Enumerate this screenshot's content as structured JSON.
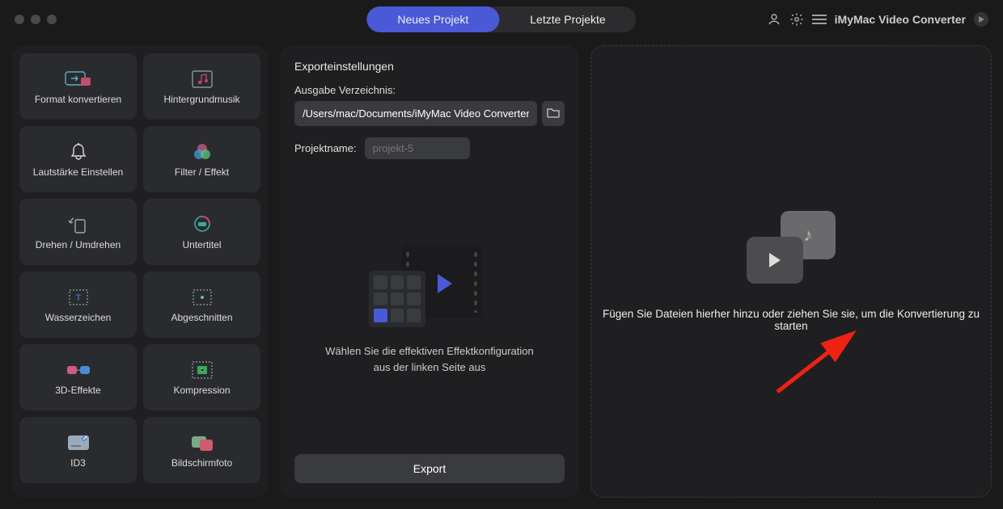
{
  "header": {
    "tab_new": "Neues Projekt",
    "tab_recent": "Letzte Projekte",
    "brand": "iMyMac Video Converter"
  },
  "tools": [
    {
      "id": "format-konvertieren",
      "label": "Format konvertieren"
    },
    {
      "id": "hintergrundmusik",
      "label": "Hintergrundmusik"
    },
    {
      "id": "lautstaerke",
      "label": "Lautstärke Einstellen"
    },
    {
      "id": "filter-effekt",
      "label": "Filter / Effekt"
    },
    {
      "id": "drehen",
      "label": "Drehen / Umdrehen"
    },
    {
      "id": "untertitel",
      "label": "Untertitel"
    },
    {
      "id": "wasserzeichen",
      "label": "Wasserzeichen"
    },
    {
      "id": "abgeschnitten",
      "label": "Abgeschnitten"
    },
    {
      "id": "3d-effekte",
      "label": "3D-Effekte"
    },
    {
      "id": "kompression",
      "label": "Kompression"
    },
    {
      "id": "id3",
      "label": "ID3"
    },
    {
      "id": "bildschirmfoto",
      "label": "Bildschirmfoto"
    }
  ],
  "export": {
    "section_title": "Exporteinstellungen",
    "output_dir_label": "Ausgabe Verzeichnis:",
    "output_dir_value": "/Users/mac/Documents/iMyMac Video Converter",
    "project_label": "Projektname:",
    "project_placeholder": "projekt-5",
    "hint_line1": "Wählen Sie die effektiven Effektkonfiguration",
    "hint_line2": "aus der linken Seite aus",
    "button": "Export"
  },
  "drop": {
    "text": "Fügen Sie Dateien hierher hinzu oder ziehen Sie sie, um die Konvertierung zu starten"
  },
  "colors": {
    "accent": "#4a59d6"
  }
}
